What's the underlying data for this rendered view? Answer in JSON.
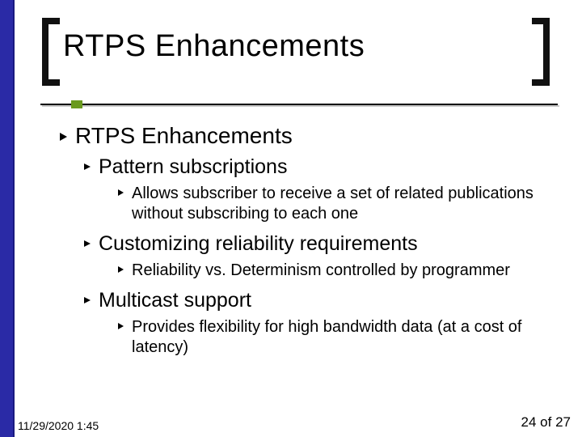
{
  "title": "RTPS Enhancements",
  "outline": {
    "heading": "RTPS Enhancements",
    "items": [
      {
        "label": "Pattern subscriptions",
        "detail": "Allows subscriber to receive a set of related publications without subscribing to each one"
      },
      {
        "label": "Customizing reliability requirements",
        "detail": "Reliability vs. Determinism controlled by programmer"
      },
      {
        "label": "Multicast support",
        "detail": "Provides flexibility for high bandwidth data (at a cost of latency)"
      }
    ]
  },
  "footer": {
    "datetime": "11/29/2020 1:45",
    "page": "24 of 27"
  }
}
